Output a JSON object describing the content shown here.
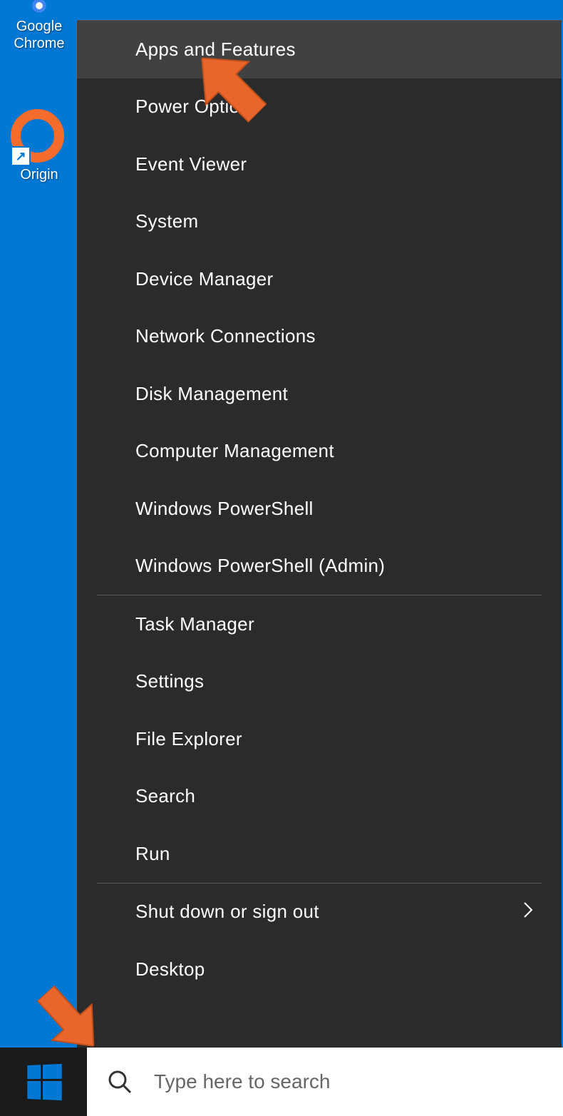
{
  "desktop": {
    "icons": [
      {
        "name": "chrome",
        "label": "Google Chrome"
      },
      {
        "name": "origin",
        "label": "Origin"
      }
    ]
  },
  "winx_menu": {
    "groups": [
      [
        {
          "label": "Apps and Features",
          "highlighted": true
        },
        {
          "label": "Power Options"
        },
        {
          "label": "Event Viewer"
        },
        {
          "label": "System"
        },
        {
          "label": "Device Manager"
        },
        {
          "label": "Network Connections"
        },
        {
          "label": "Disk Management"
        },
        {
          "label": "Computer Management"
        },
        {
          "label": "Windows PowerShell"
        },
        {
          "label": "Windows PowerShell (Admin)"
        }
      ],
      [
        {
          "label": "Task Manager"
        },
        {
          "label": "Settings"
        },
        {
          "label": "File Explorer"
        },
        {
          "label": "Search"
        },
        {
          "label": "Run"
        }
      ],
      [
        {
          "label": "Shut down or sign out",
          "has_submenu": true
        },
        {
          "label": "Desktop"
        }
      ]
    ]
  },
  "taskbar": {
    "search_placeholder": "Type here to search"
  },
  "annotations": {
    "arrow_top_target": "Apps and Features",
    "arrow_bottom_target": "Start Button"
  }
}
